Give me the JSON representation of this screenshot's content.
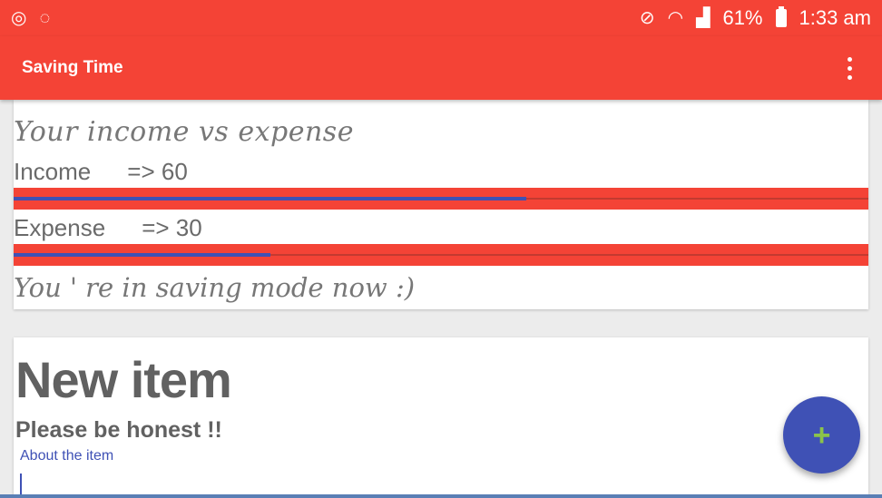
{
  "status_bar": {
    "battery": "61%",
    "time": "1:33 am"
  },
  "app_bar": {
    "title": "Saving Time"
  },
  "summary_card": {
    "title": "Your income vs expense",
    "income_label": "Income",
    "income_value": "=> 60",
    "income_progress": 0.6,
    "expense_label": "Expense",
    "expense_value": "=> 30",
    "expense_progress": 0.3,
    "message": "You ' re in saving mode now :)"
  },
  "new_item_card": {
    "title": "New item",
    "subtitle": "Please be honest !!",
    "about_label": "About the item",
    "about_value": ""
  },
  "fab": {
    "icon": "plus-icon",
    "label": "+"
  },
  "colors": {
    "primary": "#f44336",
    "accent": "#3f51b5",
    "fab_icon": "#8bc34a"
  }
}
